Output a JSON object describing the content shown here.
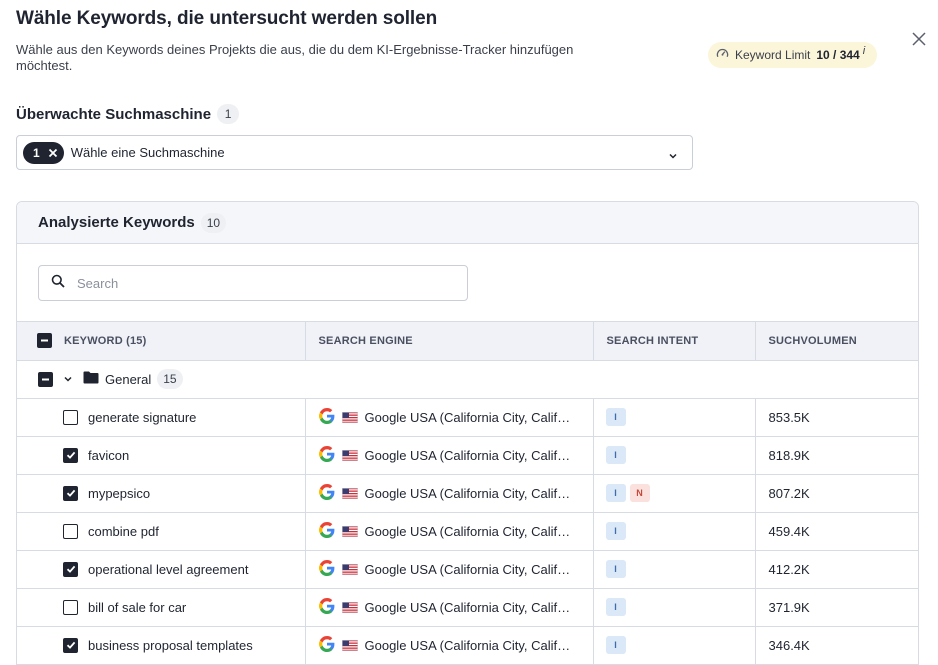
{
  "header": {
    "title": "Wähle Keywords, die untersucht werden sollen",
    "subtitle": "Wähle aus den Keywords deines Projekts die aus, die du dem KI-Ergebnisse-Tracker hinzufügen möchtest.",
    "limit_label": "Keyword Limit",
    "limit_value": "10 / 344",
    "limit_info": "i"
  },
  "search_engine": {
    "label": "Überwachte Suchmaschine",
    "count": "1",
    "chip_count": "1",
    "placeholder": "Wähle eine Suchmaschine"
  },
  "panel": {
    "title": "Analysierte Keywords",
    "count": "10",
    "search_placeholder": "Search"
  },
  "table": {
    "headers": [
      "KEYWORD (15)",
      "SEARCH ENGINE",
      "SEARCH INTENT",
      "SUCHVOLUMEN"
    ],
    "group": {
      "name": "General",
      "count": "15"
    },
    "rows": [
      {
        "keyword": "generate signature",
        "checked": false,
        "engine": "Google USA (California City, California)",
        "intents": [
          "I"
        ],
        "volume": "853.5K"
      },
      {
        "keyword": "favicon",
        "checked": true,
        "engine": "Google USA (California City, California)",
        "intents": [
          "I"
        ],
        "volume": "818.9K"
      },
      {
        "keyword": "mypepsico",
        "checked": true,
        "engine": "Google USA (California City, California)",
        "intents": [
          "I",
          "N"
        ],
        "volume": "807.2K"
      },
      {
        "keyword": "combine pdf",
        "checked": false,
        "engine": "Google USA (California City, California)",
        "intents": [
          "I"
        ],
        "volume": "459.4K"
      },
      {
        "keyword": "operational level agreement",
        "checked": true,
        "engine": "Google USA (California City, California)",
        "intents": [
          "I"
        ],
        "volume": "412.2K"
      },
      {
        "keyword": "bill of sale for car",
        "checked": false,
        "engine": "Google USA (California City, California)",
        "intents": [
          "I"
        ],
        "volume": "371.9K"
      },
      {
        "keyword": "business proposal templates",
        "checked": true,
        "engine": "Google USA (California City, California)",
        "intents": [
          "I"
        ],
        "volume": "346.4K"
      }
    ]
  },
  "colors": {
    "intent_I_bg": "#dbe8f7",
    "intent_I_fg": "#3d6ea8",
    "intent_N_bg": "#fbe1dd",
    "intent_N_fg": "#c4493a",
    "limit_bg": "#fbf5d9"
  },
  "icons": [
    "close-icon",
    "gauge-icon",
    "chevron-down-icon",
    "search-icon",
    "folder-icon",
    "google-icon",
    "us-flag-icon",
    "checkbox-icon"
  ]
}
